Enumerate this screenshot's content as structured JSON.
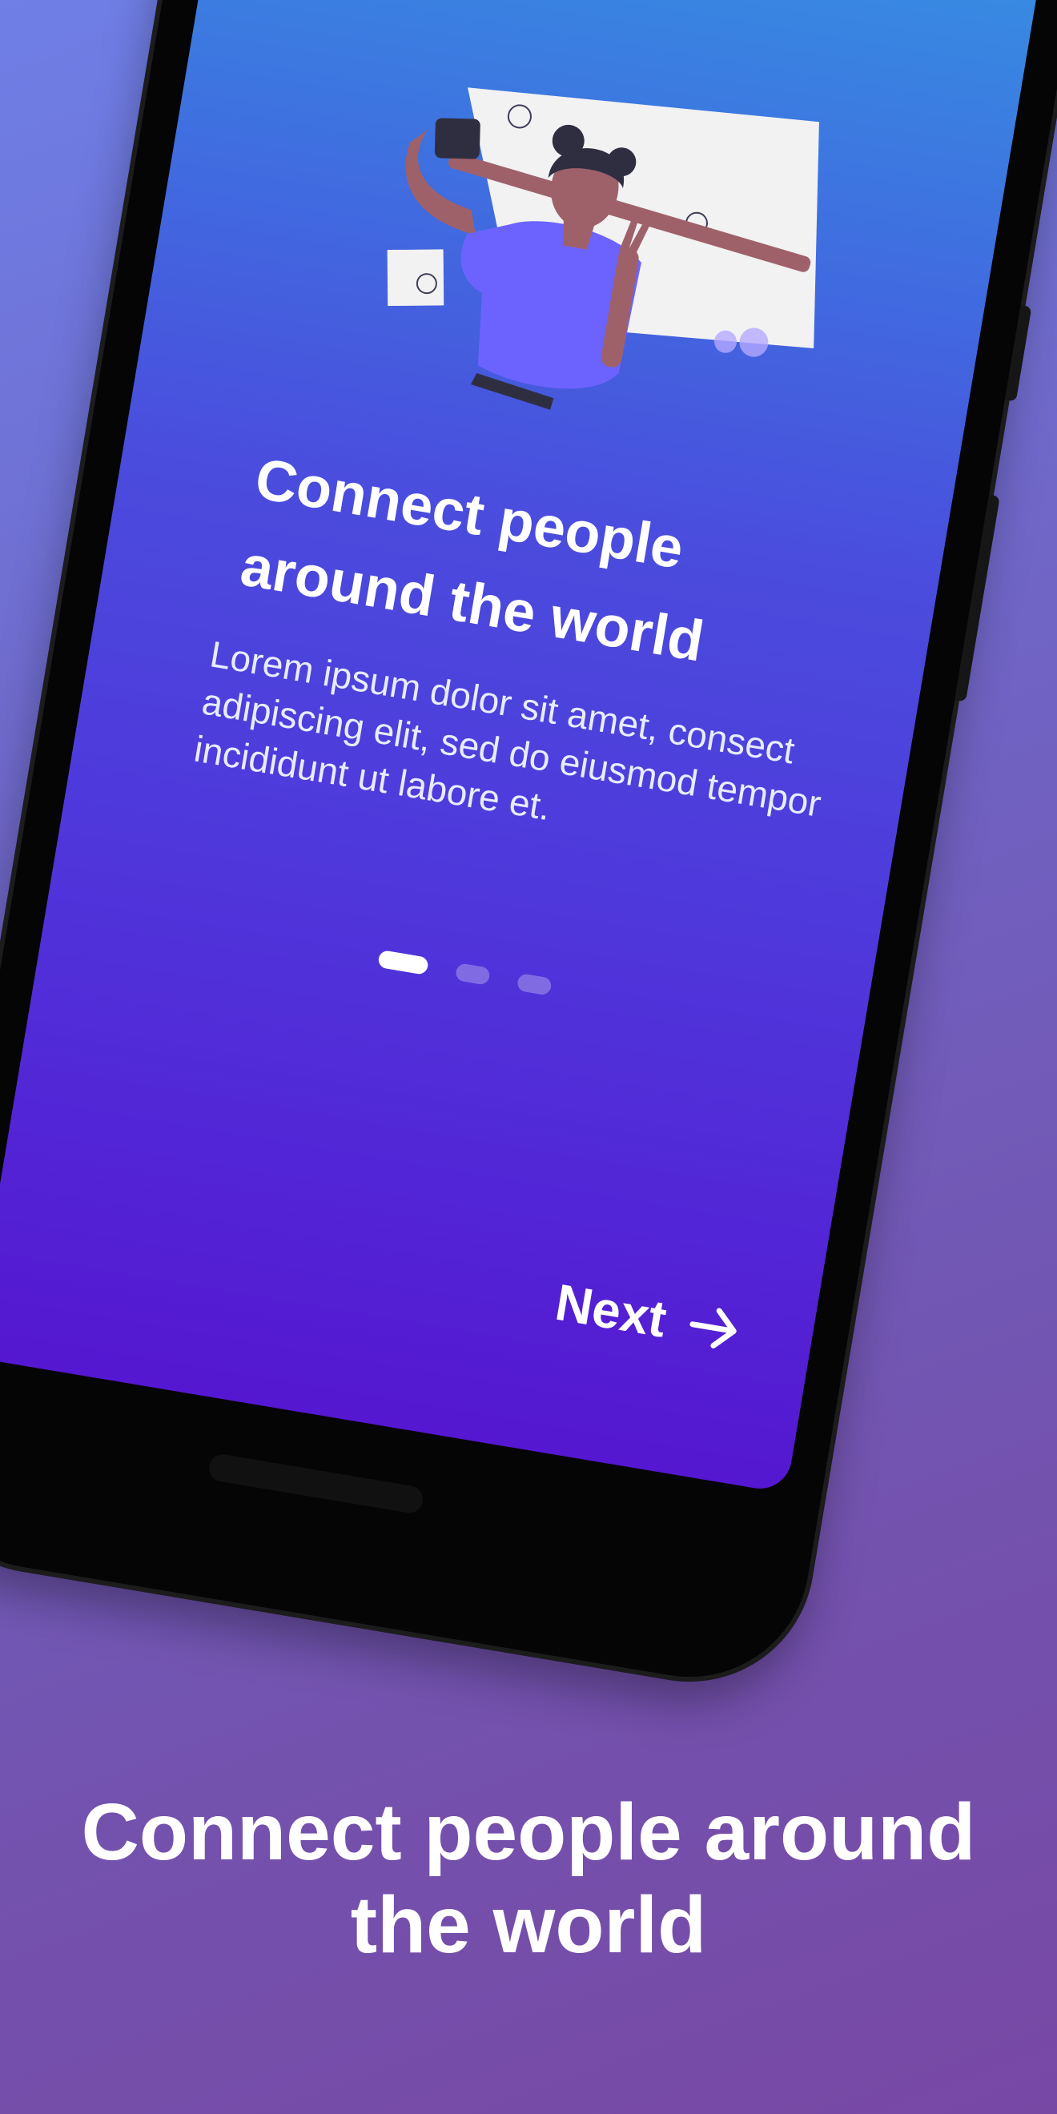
{
  "app": {
    "onboarding_title_line1": "Connect people",
    "onboarding_title_line2": "around the world",
    "onboarding_description": "Lorem ipsum dolor sit amet, consect adipiscing elit, sed do eiusmod tempor incididunt ut labore et.",
    "next_label": "Next",
    "page_indicator": {
      "total": 3,
      "active": 1
    }
  },
  "caption": {
    "line1": "Connect people around",
    "line2": "the world"
  },
  "icons": {
    "next": "arrow-right-icon",
    "illustration": "selfie-woman-illustration"
  },
  "colors": {
    "background_top": "#6f7fe6",
    "background_bottom": "#7848a5",
    "screen_top": "#3592e2",
    "screen_bottom": "#5517d1",
    "accent_purple": "#6c63ff",
    "text": "#ffffff"
  }
}
